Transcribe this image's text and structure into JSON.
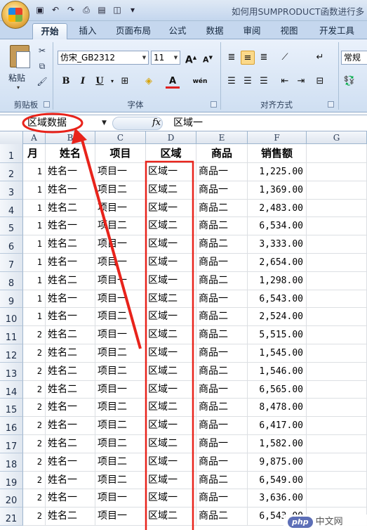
{
  "title_bar": {
    "title": "如何用SUMPRODUCT函数进行多",
    "qat_icons": [
      "save-icon",
      "undo-icon",
      "redo-icon",
      "print-preview-icon",
      "print-icon",
      "screenshot-icon",
      "dropdown-icon"
    ]
  },
  "tabs": [
    "开始",
    "插入",
    "页面布局",
    "公式",
    "数据",
    "审阅",
    "视图",
    "开发工具"
  ],
  "active_tab": "开始",
  "ribbon": {
    "clipboard": {
      "paste_label": "粘贴",
      "group_label": "剪贴板"
    },
    "font": {
      "font_name": "仿宋_GB2312",
      "font_size": "11",
      "grow_label": "A",
      "shrink_label": "A",
      "bold": "B",
      "italic": "I",
      "underline": "U",
      "font_color_label": "A",
      "phonetic_label": "wén",
      "group_label": "字体"
    },
    "alignment": {
      "group_label": "对齐方式"
    },
    "number": {
      "format_label": "常规"
    }
  },
  "formula_bar": {
    "name_box": "区域数据",
    "fx": "fx",
    "formula": "区域一"
  },
  "columns": [
    "A",
    "B",
    "C",
    "D",
    "E",
    "F",
    "G"
  ],
  "header_row": [
    "月",
    "姓名",
    "项目",
    "区域",
    "商品",
    "销售额",
    ""
  ],
  "rows": [
    [
      "1",
      "姓名一",
      "项目一",
      "区域一",
      "商品一",
      "1,225.00"
    ],
    [
      "1",
      "姓名一",
      "项目二",
      "区域二",
      "商品一",
      "1,369.00"
    ],
    [
      "1",
      "姓名二",
      "项目一",
      "区域一",
      "商品二",
      "2,483.00"
    ],
    [
      "1",
      "姓名一",
      "项目二",
      "区域二",
      "商品二",
      "6,534.00"
    ],
    [
      "1",
      "姓名二",
      "项目一",
      "区域一",
      "商品二",
      "3,333.00"
    ],
    [
      "1",
      "姓名一",
      "项目一",
      "区域一",
      "商品一",
      "2,654.00"
    ],
    [
      "1",
      "姓名二",
      "项目一",
      "区域一",
      "商品二",
      "1,298.00"
    ],
    [
      "1",
      "姓名一",
      "项目一",
      "区域二",
      "商品一",
      "6,543.00"
    ],
    [
      "1",
      "姓名一",
      "项目二",
      "区域一",
      "商品二",
      "2,524.00"
    ],
    [
      "2",
      "姓名二",
      "项目一",
      "区域二",
      "商品二",
      "5,515.00"
    ],
    [
      "2",
      "姓名二",
      "项目二",
      "区域一",
      "商品一",
      "1,545.00"
    ],
    [
      "2",
      "姓名二",
      "项目二",
      "区域二",
      "商品二",
      "1,546.00"
    ],
    [
      "2",
      "姓名二",
      "项目一",
      "区域一",
      "商品一",
      "6,565.00"
    ],
    [
      "2",
      "姓名一",
      "项目二",
      "区域二",
      "商品二",
      "8,478.00"
    ],
    [
      "2",
      "姓名一",
      "项目二",
      "区域一",
      "商品一",
      "6,417.00"
    ],
    [
      "2",
      "姓名二",
      "项目二",
      "区域二",
      "商品一",
      "1,582.00"
    ],
    [
      "2",
      "姓名一",
      "项目二",
      "区域一",
      "商品一",
      "9,875.00"
    ],
    [
      "2",
      "姓名一",
      "项目二",
      "区域一",
      "商品二",
      "6,549.00"
    ],
    [
      "2",
      "姓名一",
      "项目一",
      "区域一",
      "商品一",
      "3,636.00"
    ],
    [
      "2",
      "姓名二",
      "项目一",
      "区域二",
      "商品二",
      "6,543.00"
    ]
  ],
  "annotation_color": "#e8231b",
  "watermark": {
    "badge": "php",
    "text": "中文网"
  }
}
